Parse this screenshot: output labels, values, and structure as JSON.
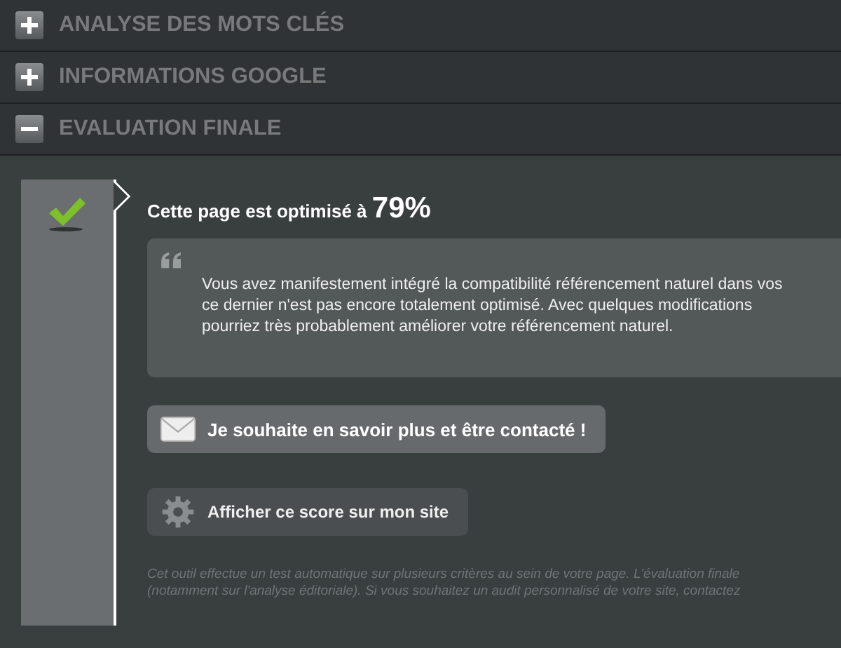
{
  "sections": [
    {
      "title": "ANALYSE DES MOTS CLÉS",
      "expanded": false
    },
    {
      "title": "INFORMATIONS GOOGLE",
      "expanded": false
    },
    {
      "title": "EVALUATION FINALE",
      "expanded": true
    }
  ],
  "evaluation": {
    "headline": "Cette page est optimisé à",
    "score": "79%",
    "quote_lines": [
      "Vous avez manifestement intégré la compatibilité référencement naturel dans vos",
      "ce dernier n'est pas encore totalement optimisé. Avec quelques modifications",
      "pourriez très probablement améliorer votre référencement naturel."
    ],
    "buttons": [
      {
        "kind": "mail",
        "label": "Je souhaite en savoir plus et être contacté !"
      },
      {
        "kind": "gear",
        "label": "Afficher ce score sur mon site"
      }
    ],
    "footnote_lines": [
      "Cet outil effectue un test automatique sur plusieurs critères au sein de votre page. L'évaluation finale",
      "(notamment sur l'analyse éditoriale). Si vous souhaitez un audit personnalisé de votre site, contactez"
    ]
  }
}
